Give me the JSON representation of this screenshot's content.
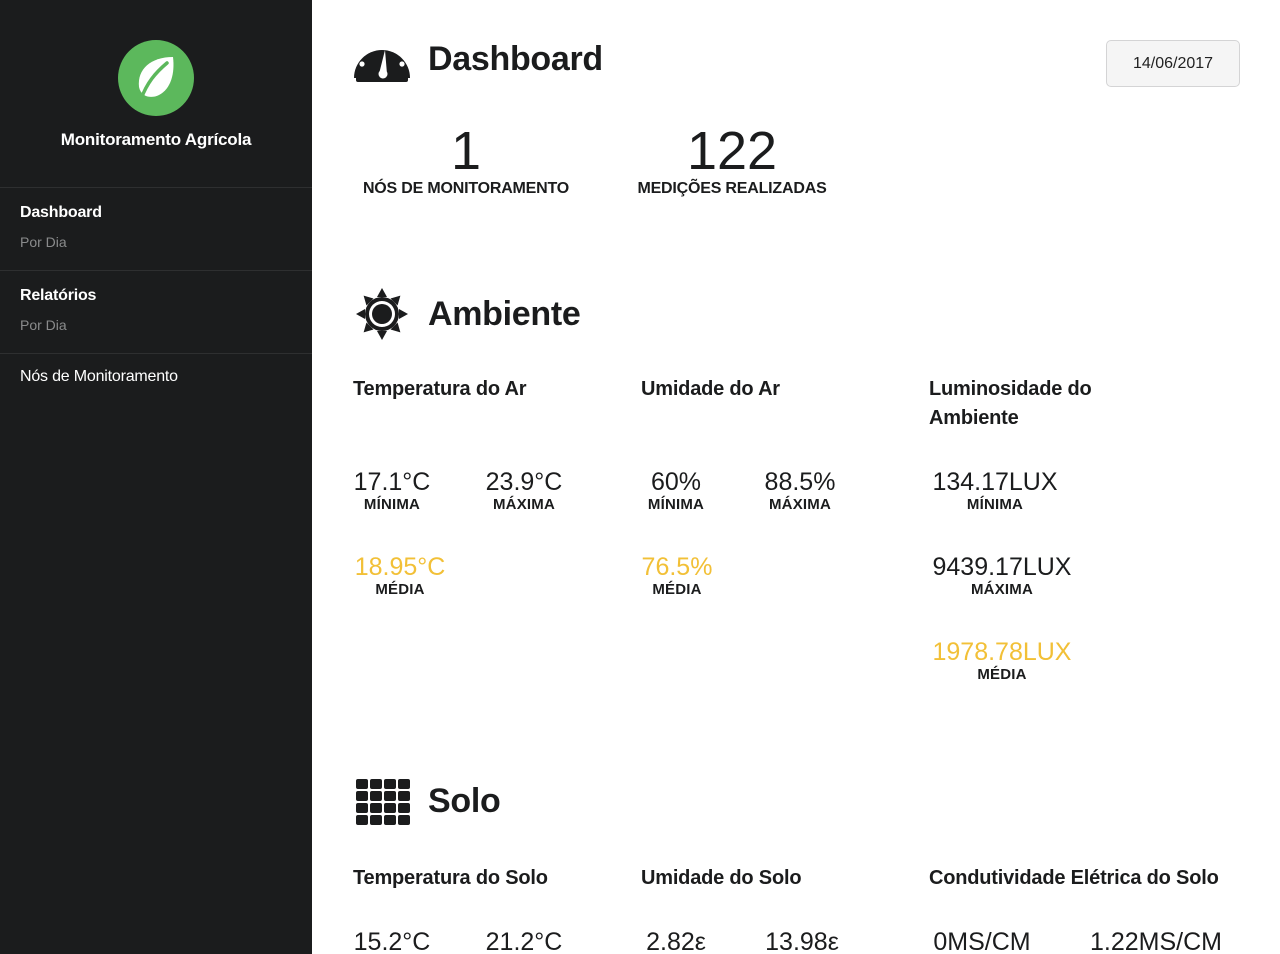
{
  "sidebar": {
    "brand": "Monitoramento Agrícola",
    "logo_icon": "leaf-icon",
    "items": [
      {
        "label": "Dashboard",
        "sub": "Por Dia"
      },
      {
        "label": "Relatórios",
        "sub": "Por Dia"
      },
      {
        "label": "Nós de Monitoramento"
      }
    ]
  },
  "header": {
    "title": "Dashboard",
    "icon": "dashboard-icon",
    "date": "14/06/2017"
  },
  "stats": [
    {
      "value": "1",
      "label": "NÓS DE MONITORAMENTO"
    },
    {
      "value": "122",
      "label": "MEDIÇÕES REALIZADAS"
    }
  ],
  "ambiente": {
    "title": "Ambiente",
    "icon": "sun-icon",
    "temp_ar": {
      "title": "Temperatura do Ar",
      "min": "17.1°C",
      "min_label": "MÍNIMA",
      "max": "23.9°C",
      "max_label": "MÁXIMA",
      "avg": "18.95°C",
      "avg_label": "MÉDIA"
    },
    "umid_ar": {
      "title": "Umidade do Ar",
      "min": "60%",
      "min_label": "MÍNIMA",
      "max": "88.5%",
      "max_label": "MÁXIMA",
      "avg": "76.5%",
      "avg_label": "MÉDIA"
    },
    "luz": {
      "title": "Luminosidade do Ambiente",
      "min": "134.17LUX",
      "min_label": "MÍNIMA",
      "max": "9439.17LUX",
      "max_label": "MÁXIMA",
      "avg": "1978.78LUX",
      "avg_label": "MÉDIA"
    }
  },
  "solo": {
    "title": "Solo",
    "icon": "grid-icon",
    "temp_solo": {
      "title": "Temperatura do Solo",
      "min": "15.2°C",
      "max": "21.2°C"
    },
    "umid_solo": {
      "title": "Umidade do Solo",
      "min": "2.82ε",
      "max": "13.98ε"
    },
    "cond_solo": {
      "title": "Condutividade Elétrica do Solo",
      "min": "0MS/CM",
      "max": "1.22MS/CM"
    }
  },
  "colors": {
    "sidebar_bg": "#1b1c1d",
    "logo_green": "#5cb85c",
    "avg_yellow": "#f2c037"
  }
}
